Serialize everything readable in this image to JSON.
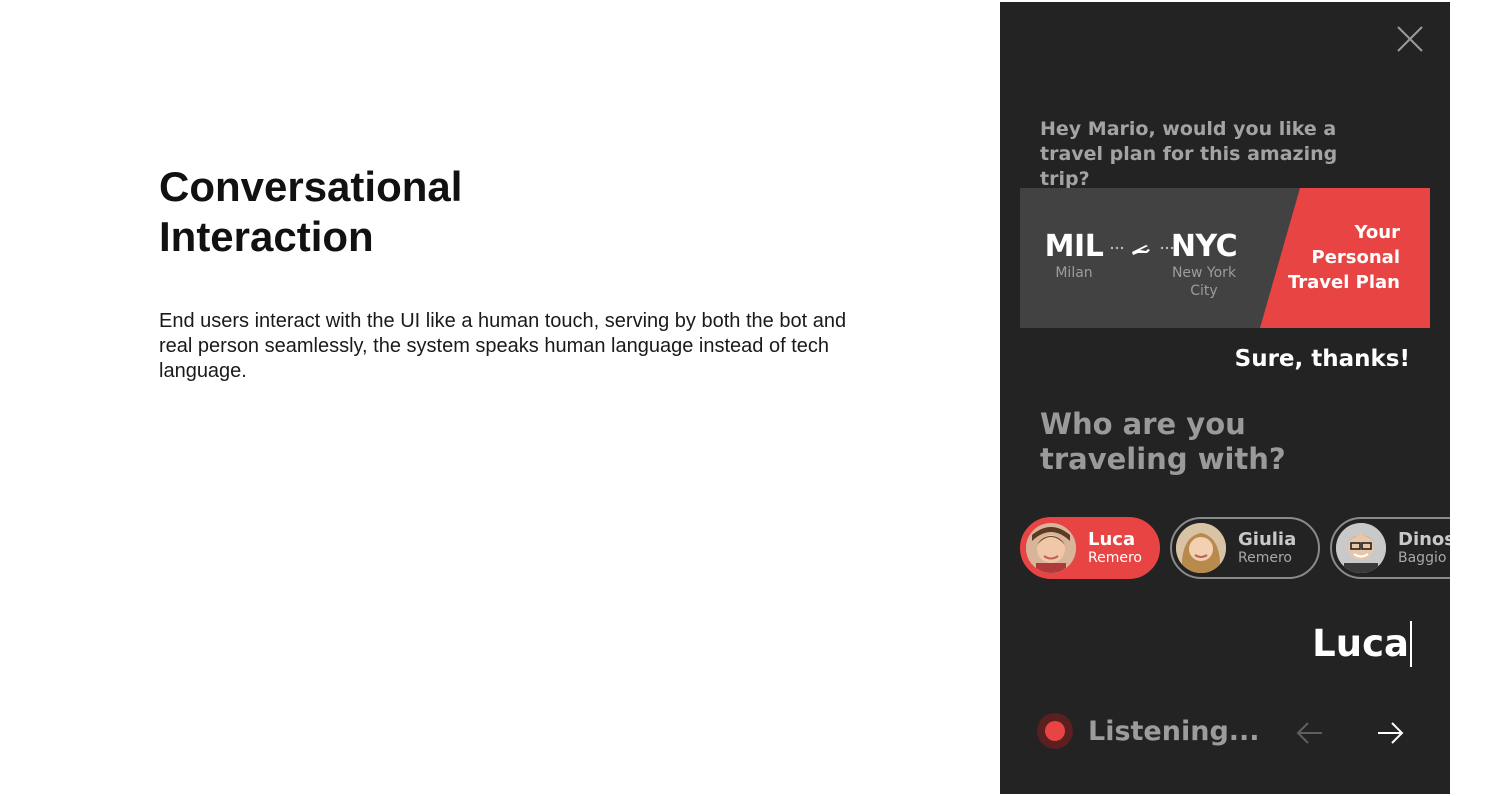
{
  "slide": {
    "title": "Conversational Interaction",
    "description": "End users interact with the UI like a human touch, serving by both the bot and real person seamlessly, the system speaks human language instead of tech language."
  },
  "chat": {
    "bot_question_1": "Hey Mario, would you like a travel plan for this amazing trip?",
    "flight": {
      "from_code": "MIL",
      "from_city": "Milan",
      "to_code": "NYC",
      "to_city": "New York City",
      "plan_label": "Your Personal Travel Plan",
      "icon": "airplane-icon"
    },
    "user_reply": "Sure, thanks!",
    "bot_question_2": "Who are you traveling with?",
    "contacts": [
      {
        "name": "Luca",
        "surname": "Remero",
        "selected": true
      },
      {
        "name": "Giulia",
        "surname": "Remero",
        "selected": false
      },
      {
        "name": "Dinosi",
        "surname": "Baggio",
        "selected": false
      }
    ],
    "typed_input": "Luca",
    "status": "Listening..."
  },
  "icons": {
    "close": "close-icon",
    "mic": "record-icon",
    "back": "arrow-left-icon",
    "next": "arrow-right-icon"
  },
  "colors": {
    "panel_bg": "#232323",
    "card_bg": "#424242",
    "accent": "#e84444",
    "muted_text": "#9c9c9c"
  }
}
